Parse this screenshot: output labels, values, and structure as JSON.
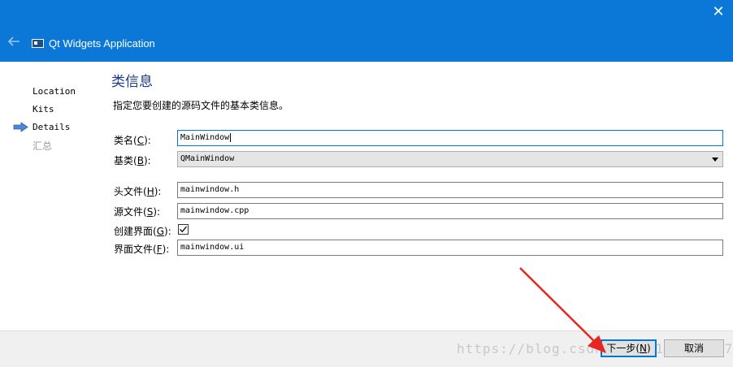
{
  "window": {
    "title": "Qt Widgets Application",
    "close_glyph": "✕",
    "icons": {
      "back": "back-arrow-icon",
      "app": "qt-app-icon",
      "close": "close-icon"
    },
    "accent_color": "#0b78d7"
  },
  "nav": {
    "items": [
      {
        "label": "Location",
        "state": "done"
      },
      {
        "label": "Kits",
        "state": "done"
      },
      {
        "label": "Details",
        "state": "current"
      },
      {
        "label": "汇总",
        "state": "pending"
      }
    ],
    "current_icon": "current-step-arrow-icon"
  },
  "page": {
    "title": "类信息",
    "description": "指定您要创建的源码文件的基本类信息。"
  },
  "form": {
    "class_name": {
      "label": "类名",
      "mnemonic": "C",
      "value": "MainWindow"
    },
    "base_class": {
      "label": "基类",
      "mnemonic": "B",
      "value": "QMainWindow"
    },
    "header_file": {
      "label": "头文件",
      "mnemonic": "H",
      "value": "mainwindow.h"
    },
    "source_file": {
      "label": "源文件",
      "mnemonic": "S",
      "value": "mainwindow.cpp"
    },
    "create_form": {
      "label": "创建界面",
      "mnemonic": "G",
      "checked": true
    },
    "form_file": {
      "label": "界面文件",
      "mnemonic": "F",
      "value": "mainwindow.ui"
    }
  },
  "footer": {
    "next_label": "下一步",
    "next_mnemonic": "N",
    "cancel_label": "取消"
  },
  "watermark": "https://blog.csdn.net/a120320157"
}
